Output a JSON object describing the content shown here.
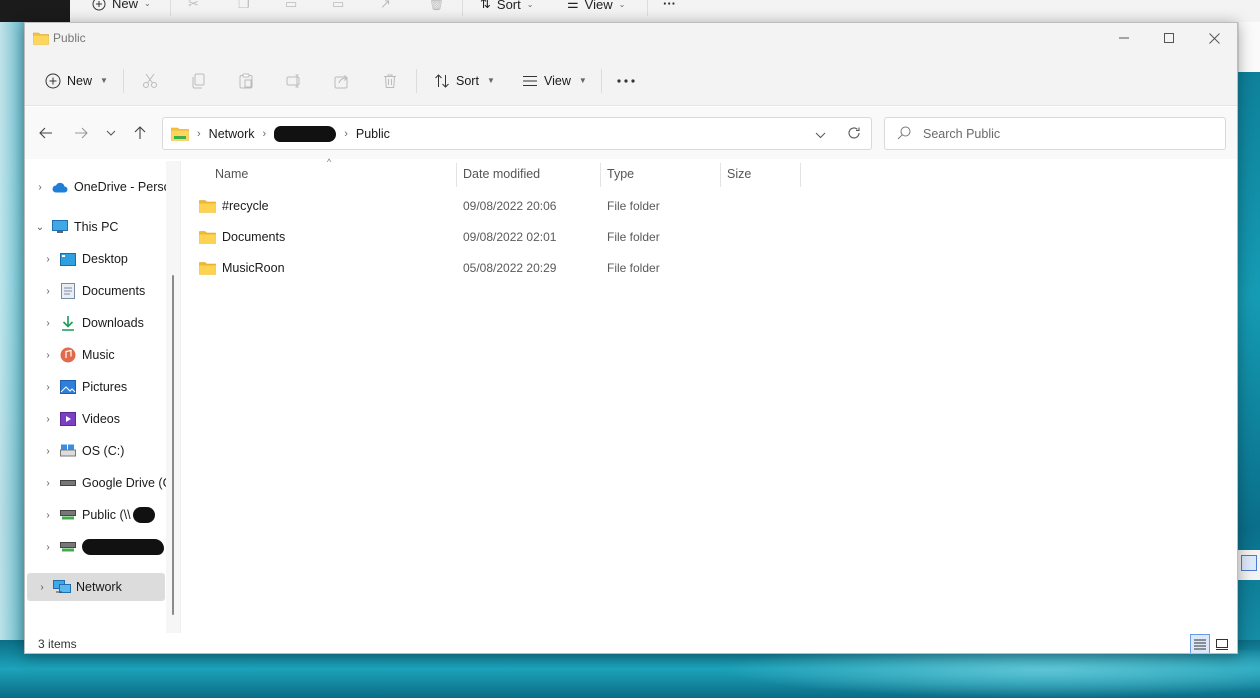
{
  "background_window": {
    "new_label": "New",
    "sort_label": "Sort",
    "view_label": "View"
  },
  "window": {
    "title": "Public",
    "toolbar": {
      "new_label": "New",
      "sort_label": "Sort",
      "view_label": "View"
    },
    "address": {
      "crumbs": [
        "Network",
        "Public"
      ]
    },
    "search": {
      "placeholder": "Search Public"
    },
    "nav": {
      "items": [
        {
          "label": "OneDrive - Perso",
          "icon": "cloud-icon"
        },
        {
          "label": "This PC",
          "icon": "computer-icon"
        },
        {
          "label": "Desktop",
          "icon": "desktop-icon"
        },
        {
          "label": "Documents",
          "icon": "documents-icon"
        },
        {
          "label": "Downloads",
          "icon": "download-icon"
        },
        {
          "label": "Music",
          "icon": "music-icon"
        },
        {
          "label": "Pictures",
          "icon": "pictures-icon"
        },
        {
          "label": "Videos",
          "icon": "videos-icon"
        },
        {
          "label": "OS (C:)",
          "icon": "drive-icon"
        },
        {
          "label": "Google Drive (G",
          "icon": "drive-icon"
        },
        {
          "label": "Public (\\\\",
          "icon": "network-drive-icon"
        },
        {
          "label": "",
          "icon": "network-drive-icon"
        },
        {
          "label": "Network",
          "icon": "network-icon"
        }
      ]
    },
    "columns": {
      "name": "Name",
      "date": "Date modified",
      "type": "Type",
      "size": "Size"
    },
    "files": [
      {
        "name": "#recycle",
        "date": "09/08/2022 20:06",
        "type": "File folder",
        "size": ""
      },
      {
        "name": "Documents",
        "date": "09/08/2022 02:01",
        "type": "File folder",
        "size": ""
      },
      {
        "name": "MusicRoon",
        "date": "05/08/2022 20:29",
        "type": "File folder",
        "size": ""
      }
    ],
    "status": {
      "item_count": "3 items"
    }
  },
  "colors": {
    "accent": "#0067c0",
    "folder": "#f4c542",
    "selection": "#dcdcdc"
  }
}
